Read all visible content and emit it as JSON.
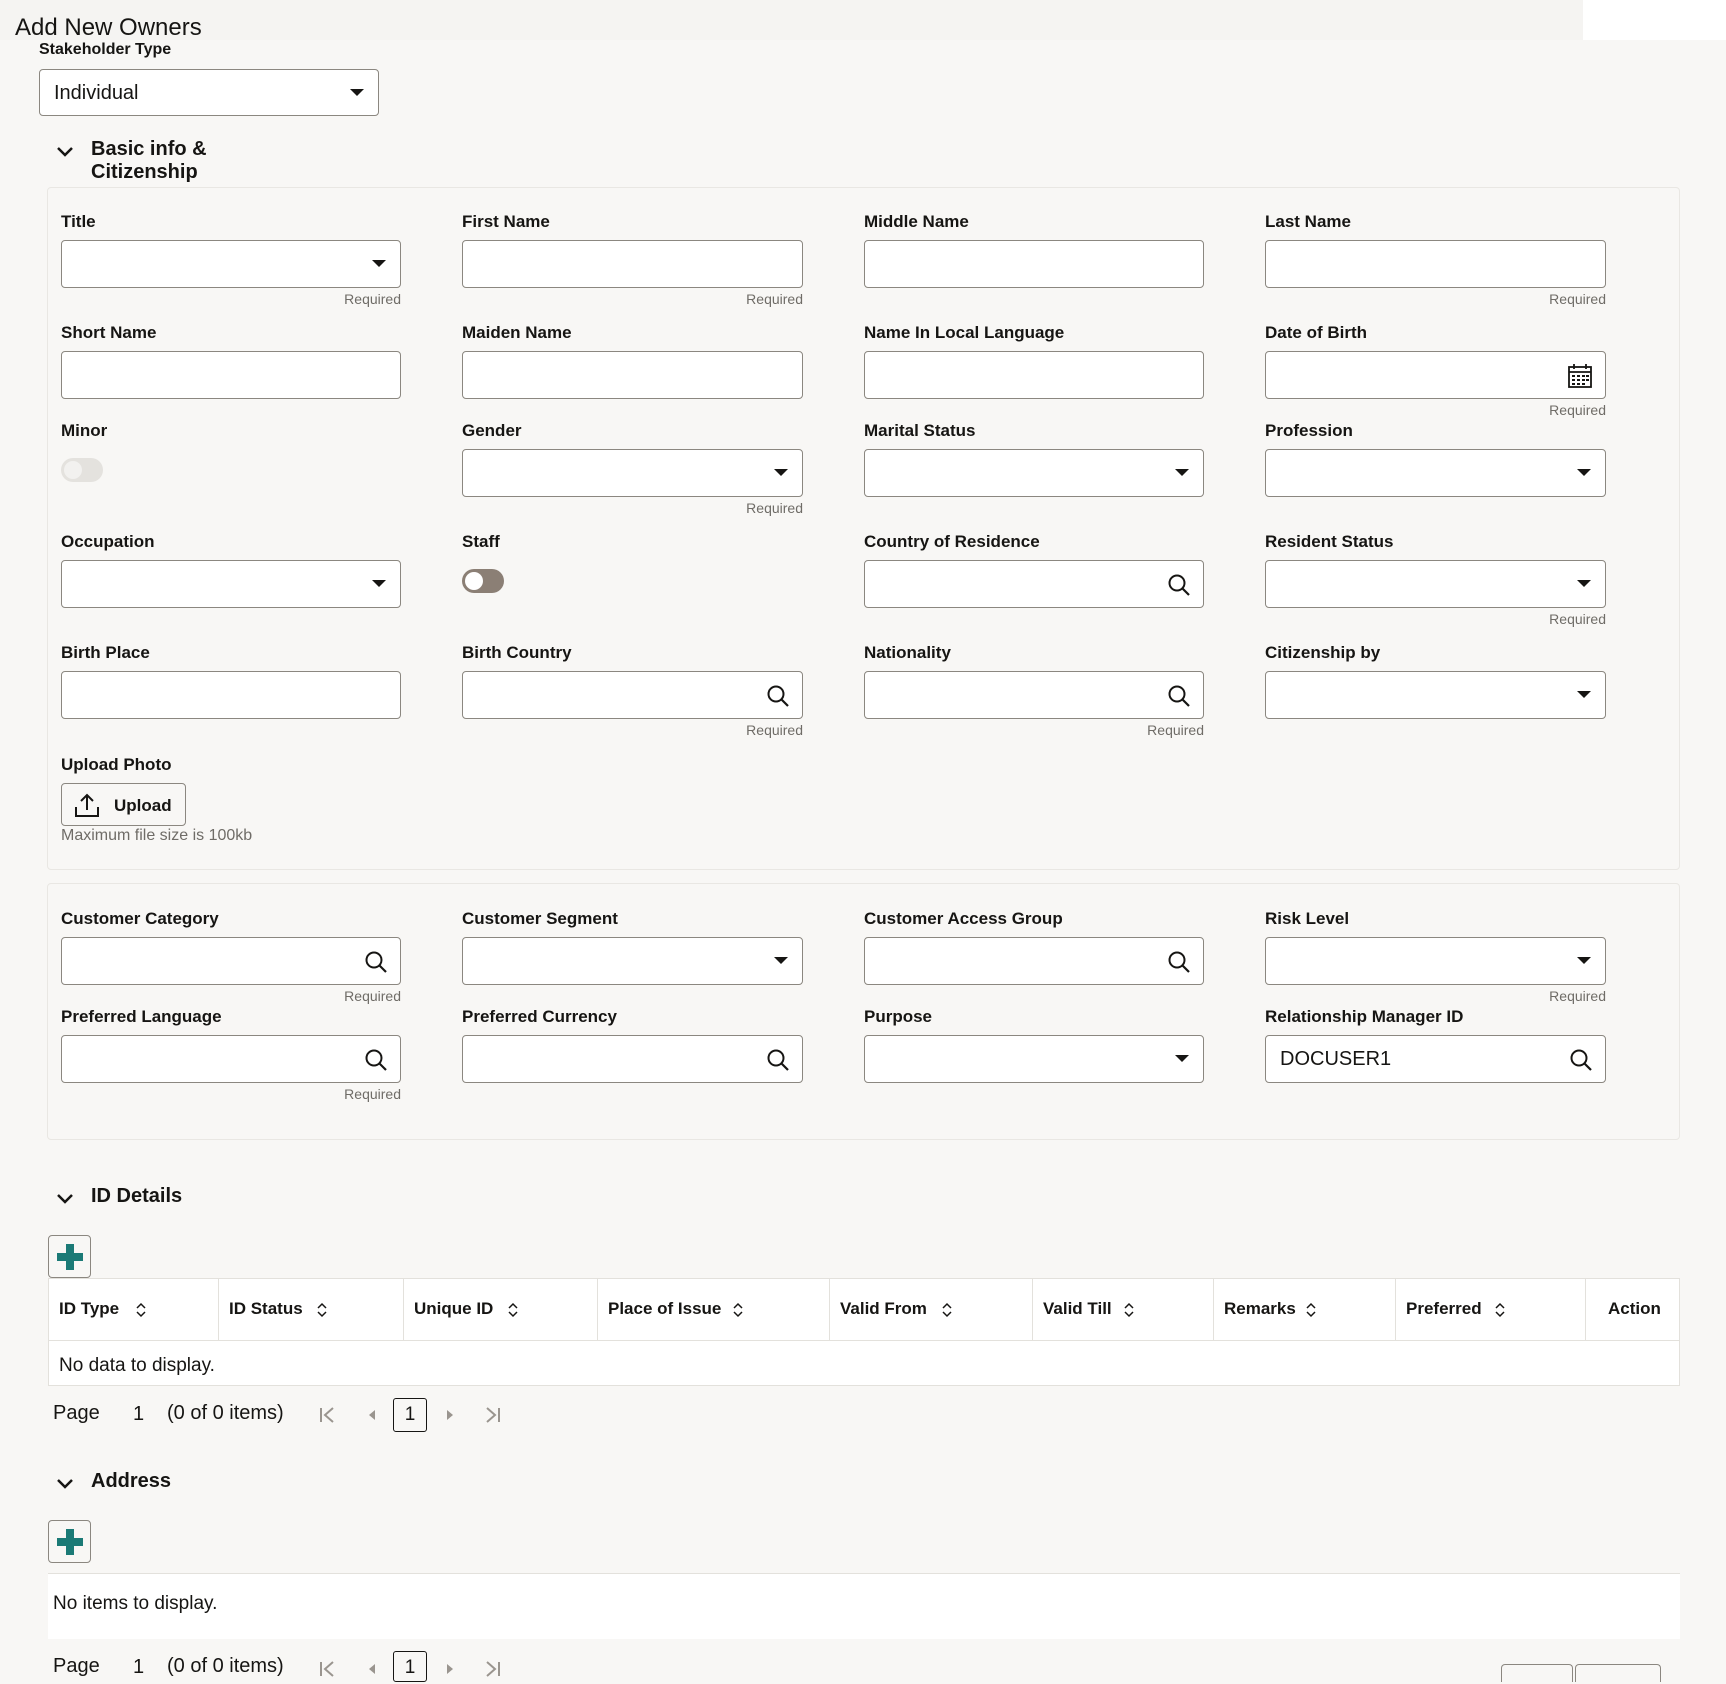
{
  "page": {
    "title": "Add New Owners"
  },
  "stakeholder": {
    "label": "Stakeholder Type",
    "value": "Individual"
  },
  "sections": {
    "basic": "Basic info & Citizenship",
    "id": "ID Details",
    "address": "Address"
  },
  "required_text": "Required",
  "basic": {
    "title": "Title",
    "first_name": "First Name",
    "middle_name": "Middle Name",
    "last_name": "Last Name",
    "short_name": "Short Name",
    "maiden_name": "Maiden Name",
    "name_local": "Name In Local Language",
    "dob": "Date of Birth",
    "minor": "Minor",
    "gender": "Gender",
    "marital": "Marital Status",
    "profession": "Profession",
    "occupation": "Occupation",
    "staff": "Staff",
    "country_res": "Country of Residence",
    "resident_status": "Resident Status",
    "birth_place": "Birth Place",
    "birth_country": "Birth Country",
    "nationality": "Nationality",
    "citizenship_by": "Citizenship by",
    "upload_photo": "Upload Photo",
    "upload_btn": "Upload",
    "max_size": "Maximum file size is 100kb"
  },
  "customer": {
    "category": "Customer Category",
    "segment": "Customer Segment",
    "access_group": "Customer Access Group",
    "risk": "Risk Level",
    "pref_lang": "Preferred Language",
    "pref_curr": "Preferred Currency",
    "purpose": "Purpose",
    "rm_id": "Relationship Manager ID",
    "rm_value": "DOCUSER1"
  },
  "id_table": {
    "columns": [
      "ID Type",
      "ID Status",
      "Unique ID",
      "Place of Issue",
      "Valid From",
      "Valid Till",
      "Remarks",
      "Preferred",
      "Action"
    ],
    "empty": "No data to display."
  },
  "address": {
    "empty": "No items to display."
  },
  "pagination": {
    "page_label": "Page",
    "page_num": "1",
    "items": "(0 of 0 items)",
    "current": "1"
  },
  "icons": {
    "add": "plus-icon",
    "search": "search-icon",
    "calendar": "calendar-icon",
    "upload": "upload-icon",
    "chevron": "chevron-down-icon"
  },
  "colors": {
    "accent": "#1b7a76",
    "toggle_on": "#8b7f75",
    "toggle_off": "#e4e2de"
  }
}
